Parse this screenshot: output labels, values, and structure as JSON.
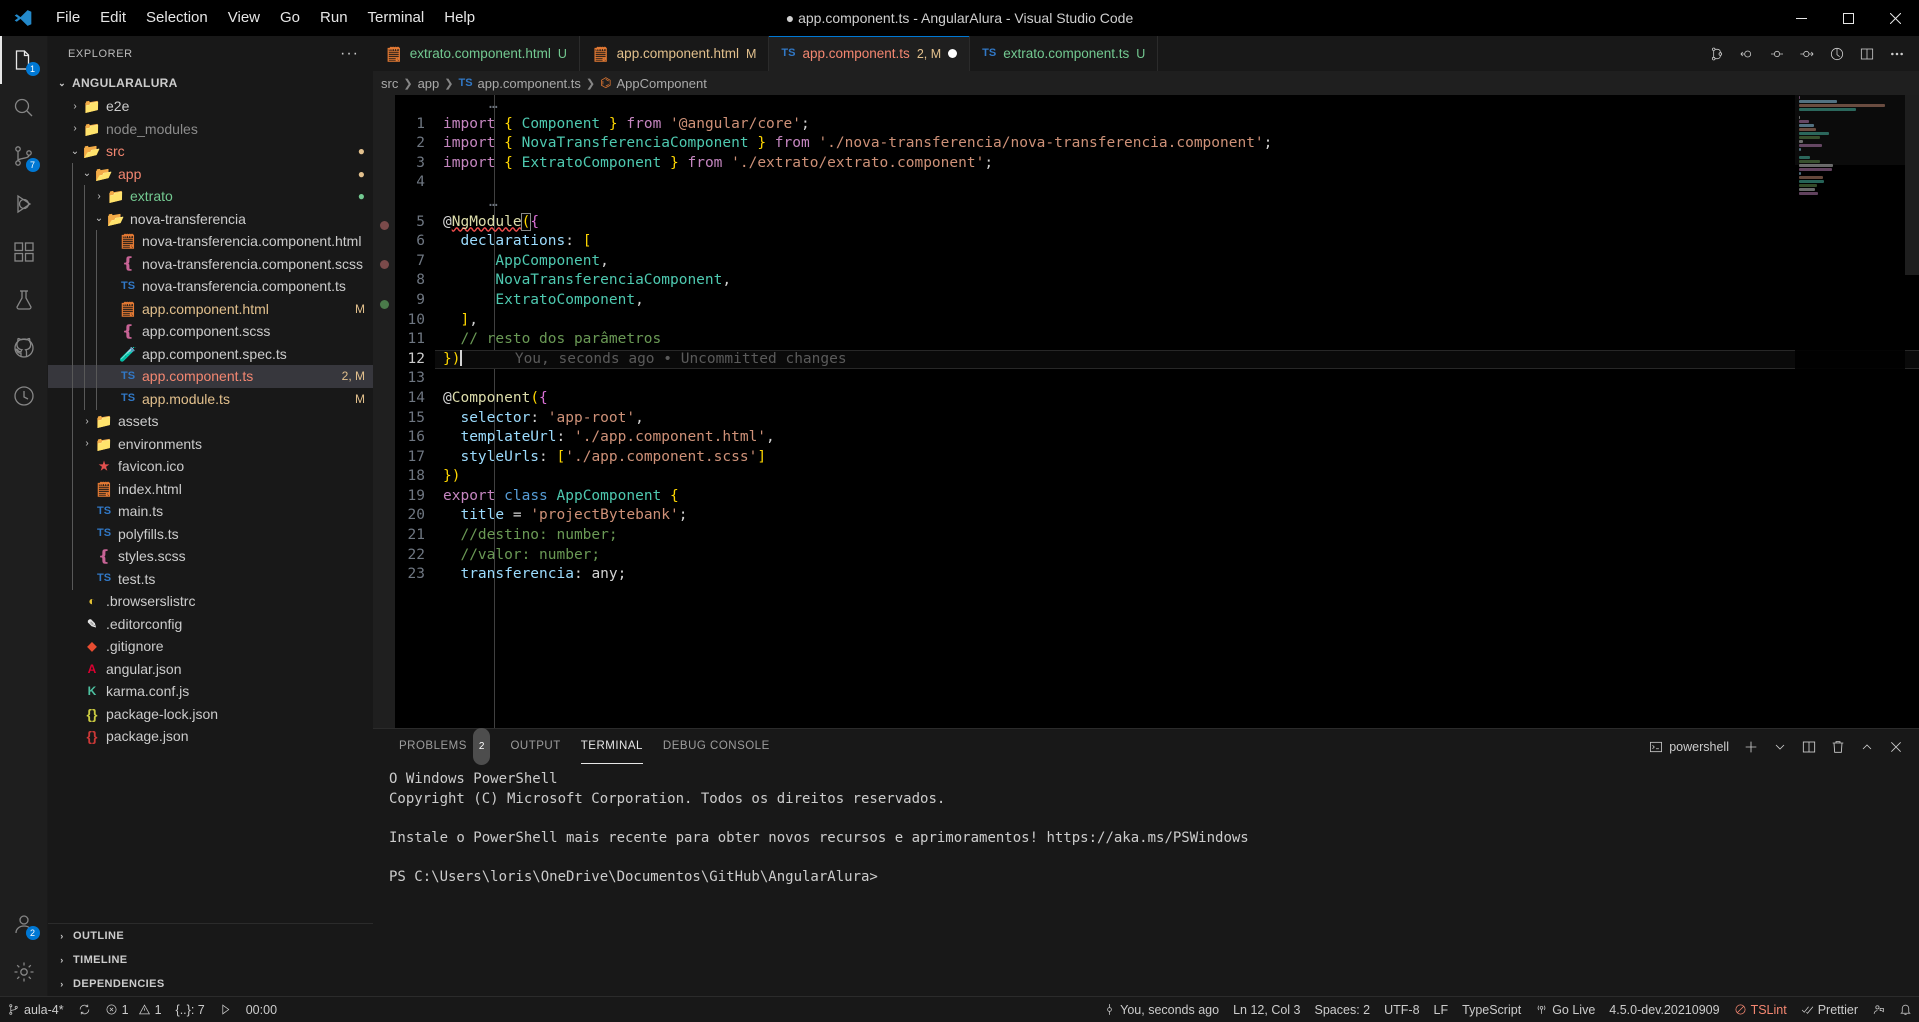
{
  "window": {
    "title": "● app.component.ts - AngularAlura - Visual Studio Code",
    "minimize": "—",
    "maximize": "▢",
    "close": "✕"
  },
  "menubar": {
    "items": [
      "File",
      "Edit",
      "Selection",
      "View",
      "Go",
      "Run",
      "Terminal",
      "Help"
    ]
  },
  "activitybar": {
    "items": [
      {
        "name": "explorer",
        "icon": "files-icon",
        "badge": "1"
      },
      {
        "name": "search",
        "icon": "search-icon",
        "badge": ""
      },
      {
        "name": "source-control",
        "icon": "source-control-icon",
        "badge": "7"
      },
      {
        "name": "run-and-debug",
        "icon": "debug-icon",
        "badge": ""
      },
      {
        "name": "extensions",
        "icon": "extensions-icon",
        "badge": ""
      },
      {
        "name": "testing",
        "icon": "beaker-icon",
        "badge": ""
      },
      {
        "name": "github",
        "icon": "github-icon",
        "badge": ""
      },
      {
        "name": "docker",
        "icon": "docker-icon",
        "badge": ""
      }
    ],
    "bottom": [
      {
        "name": "accounts",
        "icon": "account-icon",
        "badge": "2"
      },
      {
        "name": "manage",
        "icon": "gear-icon",
        "badge": ""
      }
    ]
  },
  "sidebar": {
    "header": "EXPLORER",
    "more": "···",
    "root": "ANGULARALURA",
    "tree": [
      {
        "label": "e2e",
        "type": "folder",
        "icon": "folder-e2e-icon",
        "indent": 1,
        "twisty": "›",
        "deco": "",
        "decoClass": ""
      },
      {
        "label": "node_modules",
        "type": "folder",
        "icon": "folder-node-icon",
        "indent": 1,
        "twisty": "›",
        "deco": "",
        "decoClass": "",
        "dim": true
      },
      {
        "label": "src",
        "type": "folder",
        "icon": "folder-src-icon",
        "indent": 1,
        "twisty": "⌄",
        "deco": "●",
        "decoClass": "M",
        "color": "#e2c08d"
      },
      {
        "label": "app",
        "type": "folder",
        "icon": "folder-app-icon",
        "indent": 2,
        "twisty": "⌄",
        "deco": "●",
        "decoClass": "M",
        "color": "#e2c08d"
      },
      {
        "label": "extrato",
        "type": "folder",
        "icon": "folder-icon",
        "indent": 3,
        "twisty": "›",
        "deco": "●",
        "decoClass": "U",
        "color": "#73c991"
      },
      {
        "label": "nova-transferencia",
        "type": "folder",
        "icon": "folder-open-icon",
        "indent": 3,
        "twisty": "⌄",
        "deco": "",
        "decoClass": ""
      },
      {
        "label": "nova-transferencia.component.html",
        "type": "html",
        "icon": "html-icon",
        "indent": 4,
        "twisty": "",
        "deco": "",
        "decoClass": ""
      },
      {
        "label": "nova-transferencia.component.scss",
        "type": "scss",
        "icon": "sass-icon",
        "indent": 4,
        "twisty": "",
        "deco": "",
        "decoClass": ""
      },
      {
        "label": "nova-transferencia.component.ts",
        "type": "ts",
        "icon": "typescript-icon",
        "indent": 4,
        "twisty": "",
        "deco": "",
        "decoClass": ""
      },
      {
        "label": "app.component.html",
        "type": "html",
        "icon": "html-icon",
        "indent": 4,
        "twisty": "",
        "deco": "M",
        "decoClass": "M"
      },
      {
        "label": "app.component.scss",
        "type": "scss",
        "icon": "sass-icon",
        "indent": 4,
        "twisty": "",
        "deco": "",
        "decoClass": ""
      },
      {
        "label": "app.component.spec.ts",
        "type": "spec",
        "icon": "test-icon",
        "indent": 4,
        "twisty": "",
        "deco": "",
        "decoClass": ""
      },
      {
        "label": "app.component.ts",
        "type": "ts",
        "icon": "typescript-icon",
        "indent": 4,
        "twisty": "",
        "deco": "2, M",
        "decoClass": "M",
        "selected": true
      },
      {
        "label": "app.module.ts",
        "type": "ts",
        "icon": "typescript-icon",
        "indent": 4,
        "twisty": "",
        "deco": "M",
        "decoClass": "M"
      },
      {
        "label": "assets",
        "type": "folder",
        "icon": "folder-assets-icon",
        "indent": 2,
        "twisty": "›",
        "deco": "",
        "decoClass": ""
      },
      {
        "label": "environments",
        "type": "folder",
        "icon": "folder-icon",
        "indent": 2,
        "twisty": "›",
        "deco": "",
        "decoClass": ""
      },
      {
        "label": "favicon.ico",
        "type": "ico",
        "icon": "favicon-icon",
        "indent": 2,
        "twisty": "",
        "deco": "",
        "decoClass": ""
      },
      {
        "label": "index.html",
        "type": "html",
        "icon": "html-icon",
        "indent": 2,
        "twisty": "",
        "deco": "",
        "decoClass": ""
      },
      {
        "label": "main.ts",
        "type": "ts",
        "icon": "typescript-icon",
        "indent": 2,
        "twisty": "",
        "deco": "",
        "decoClass": ""
      },
      {
        "label": "polyfills.ts",
        "type": "ts",
        "icon": "typescript-icon",
        "indent": 2,
        "twisty": "",
        "deco": "",
        "decoClass": ""
      },
      {
        "label": "styles.scss",
        "type": "scss",
        "icon": "sass-icon",
        "indent": 2,
        "twisty": "",
        "deco": "",
        "decoClass": ""
      },
      {
        "label": "test.ts",
        "type": "ts",
        "icon": "typescript-icon",
        "indent": 2,
        "twisty": "",
        "deco": "",
        "decoClass": ""
      },
      {
        "label": ".browserslistrc",
        "type": "cfg",
        "icon": "browserslist-icon",
        "indent": 1,
        "twisty": "",
        "deco": "",
        "decoClass": ""
      },
      {
        "label": ".editorconfig",
        "type": "cfg",
        "icon": "editorconfig-icon",
        "indent": 1,
        "twisty": "",
        "deco": "",
        "decoClass": ""
      },
      {
        "label": ".gitignore",
        "type": "git",
        "icon": "git-icon",
        "indent": 1,
        "twisty": "",
        "deco": "",
        "decoClass": ""
      },
      {
        "label": "angular.json",
        "type": "ng",
        "icon": "angular-icon",
        "indent": 1,
        "twisty": "",
        "deco": "",
        "decoClass": ""
      },
      {
        "label": "karma.conf.js",
        "type": "karma",
        "icon": "karma-icon",
        "indent": 1,
        "twisty": "",
        "deco": "",
        "decoClass": ""
      },
      {
        "label": "package-lock.json",
        "type": "json",
        "icon": "json-icon",
        "indent": 1,
        "twisty": "",
        "deco": "",
        "decoClass": ""
      },
      {
        "label": "package.json",
        "type": "json",
        "icon": "npm-icon",
        "indent": 1,
        "twisty": "",
        "deco": "",
        "decoClass": ""
      }
    ],
    "panels": [
      "OUTLINE",
      "TIMELINE",
      "DEPENDENCIES"
    ]
  },
  "tabs": [
    {
      "name": "extrato.component.html",
      "icon": "html-icon",
      "deco": "U",
      "decoColor": "#73c991",
      "active": false,
      "dirty": false,
      "nameColor": "#73c991"
    },
    {
      "name": "app.component.html",
      "icon": "html-icon",
      "deco": "M",
      "decoColor": "#e2c08d",
      "active": false,
      "dirty": false,
      "nameColor": "#e2c08d"
    },
    {
      "name": "app.component.ts",
      "icon": "typescript-icon",
      "deco": "2, M",
      "decoColor": "#e2c08d",
      "active": true,
      "dirty": true,
      "nameColor": "#f48771"
    },
    {
      "name": "extrato.component.ts",
      "icon": "typescript-icon",
      "deco": "U",
      "decoColor": "#73c991",
      "active": false,
      "dirty": false,
      "nameColor": "#73c991"
    }
  ],
  "editor_actions": [
    "source-control-graph-icon",
    "debug-restart-icon",
    "debug-step-over-icon",
    "debug-step-into-icon",
    "run-icon",
    "split-editor-icon",
    "more-actions-icon"
  ],
  "breadcrumb": [
    "src",
    "app",
    "app.component.ts",
    "AppComponent"
  ],
  "code": {
    "filename": "app.component.ts",
    "blame": "You, seconds ago • Uncommitted changes",
    "lines": [
      {
        "num": "",
        "fold": true,
        "text": "…"
      },
      {
        "num": "1",
        "text": "import { Component } from '@angular/core';"
      },
      {
        "num": "2",
        "text": "import { NovaTransferenciaComponent } from './nova-transferencia/nova-transferencia.component';"
      },
      {
        "num": "3",
        "text": "import { ExtratoComponent } from './extrato/extrato.component';"
      },
      {
        "num": "4",
        "text": ""
      },
      {
        "num": "",
        "fold": true,
        "text": "…"
      },
      {
        "num": "5",
        "text": "@NgModule({"
      },
      {
        "num": "6",
        "text": "  declarations: ["
      },
      {
        "num": "7",
        "text": "      AppComponent,"
      },
      {
        "num": "8",
        "text": "      NovaTransferenciaComponent,"
      },
      {
        "num": "9",
        "text": "      ExtratoComponent,"
      },
      {
        "num": "10",
        "text": "  ],"
      },
      {
        "num": "11",
        "text": "  // resto dos parâmetros"
      },
      {
        "num": "12",
        "text": "})",
        "current": true
      },
      {
        "num": "13",
        "text": ""
      },
      {
        "num": "14",
        "text": "@Component({"
      },
      {
        "num": "15",
        "text": "  selector: 'app-root',"
      },
      {
        "num": "16",
        "text": "  templateUrl: './app.component.html',"
      },
      {
        "num": "17",
        "text": "  styleUrls: ['./app.component.scss']"
      },
      {
        "num": "18",
        "text": "})"
      },
      {
        "num": "19",
        "text": "export class AppComponent {"
      },
      {
        "num": "20",
        "text": "  title = 'projectBytebank';"
      },
      {
        "num": "21",
        "text": "  //destino: number;"
      },
      {
        "num": "22",
        "text": "  //valor: number;"
      },
      {
        "num": "23",
        "text": "  transferencia: any;"
      }
    ]
  },
  "panel": {
    "tabs": [
      {
        "label": "PROBLEMS",
        "badge": "2",
        "active": false
      },
      {
        "label": "OUTPUT",
        "badge": "",
        "active": false
      },
      {
        "label": "TERMINAL",
        "badge": "",
        "active": true
      },
      {
        "label": "DEBUG CONSOLE",
        "badge": "",
        "active": false
      }
    ],
    "shell": "powershell",
    "actions": [
      "new-terminal-icon",
      "terminal-dropdown-icon",
      "split-terminal-icon",
      "kill-terminal-icon",
      "chevron-up-icon",
      "close-panel-icon"
    ],
    "terminal_text": "O Windows PowerShell\nCopyright (C) Microsoft Corporation. Todos os direitos reservados.\n\nInstale o PowerShell mais recente para obter novos recursos e aprimoramentos! https://aka.ms/PSWindows\n\nPS C:\\Users\\loris\\OneDrive\\Documentos\\GitHub\\AngularAlura>"
  },
  "statusbar": {
    "left": [
      {
        "name": "remote-branch",
        "icon": "source-control-icon",
        "label": "aula-4*"
      },
      {
        "name": "sync-changes",
        "icon": "sync-icon",
        "label": ""
      },
      {
        "name": "errors-warnings",
        "icon": "error-icon",
        "label": "1",
        "icon2": "warning-icon",
        "label2": "1"
      },
      {
        "name": "ports",
        "icon": "",
        "label": "{..}: 7"
      },
      {
        "name": "run-task",
        "icon": "play-icon",
        "label": ""
      },
      {
        "name": "timer",
        "icon": "",
        "label": "00:00"
      }
    ],
    "right": [
      {
        "name": "git-blame",
        "icon": "git-commit-icon",
        "label": "You, seconds ago"
      },
      {
        "name": "cursor-position",
        "icon": "",
        "label": "Ln 12, Col 3"
      },
      {
        "name": "indentation",
        "icon": "",
        "label": "Spaces: 2"
      },
      {
        "name": "encoding",
        "icon": "",
        "label": "UTF-8"
      },
      {
        "name": "eol",
        "icon": "",
        "label": "LF"
      },
      {
        "name": "language-mode",
        "icon": "",
        "label": "TypeScript"
      },
      {
        "name": "go-live",
        "icon": "broadcast-icon",
        "label": "Go Live"
      },
      {
        "name": "version",
        "icon": "",
        "label": "4.5.0-dev.20210909"
      },
      {
        "name": "tslint",
        "icon": "no-entry-icon",
        "label": "TSLint"
      },
      {
        "name": "prettier",
        "icon": "check-check-icon",
        "label": "Prettier"
      },
      {
        "name": "feedback",
        "icon": "person-feedback-icon",
        "label": ""
      },
      {
        "name": "notifications",
        "icon": "bell-icon",
        "label": ""
      }
    ]
  },
  "colors": {
    "accent": "#0078d4",
    "modified": "#e2c08d",
    "untracked": "#73c991",
    "error": "#f14c4c",
    "titlebar_bg": "#000000",
    "editor_bg": "#000000",
    "sidebar_bg": "#181818"
  }
}
